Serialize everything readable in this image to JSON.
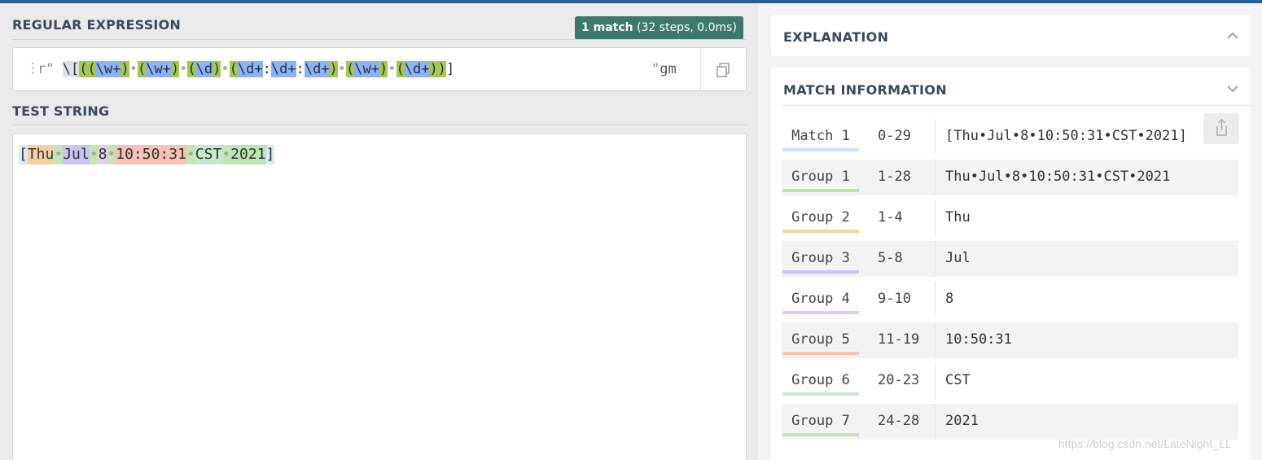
{
  "regex_section": {
    "title": "REGULAR EXPRESSION",
    "match_badge": {
      "count": "1 match",
      "detail": "(32 steps, 0.0ms)"
    },
    "delimiter_open": "r\"",
    "delimiter_close": "\"",
    "flags": "gm",
    "pattern_tokens": [
      {
        "t": "\\[",
        "k": "esc"
      },
      {
        "t": "(",
        "k": "grp"
      },
      {
        "t": "(",
        "k": "grp"
      },
      {
        "t": "\\w+",
        "k": "cls"
      },
      {
        "t": ")",
        "k": "grp"
      },
      {
        "t": "•",
        "k": "dot"
      },
      {
        "t": "(",
        "k": "grp"
      },
      {
        "t": "\\w+",
        "k": "cls"
      },
      {
        "t": ")",
        "k": "grp"
      },
      {
        "t": "•",
        "k": "dot"
      },
      {
        "t": "(",
        "k": "grp"
      },
      {
        "t": "\\d",
        "k": "cls"
      },
      {
        "t": ")",
        "k": "grp"
      },
      {
        "t": "•",
        "k": "dot"
      },
      {
        "t": "(",
        "k": "grp"
      },
      {
        "t": "\\d+",
        "k": "cls"
      },
      {
        "t": ":",
        "k": "plain"
      },
      {
        "t": "\\d+",
        "k": "cls"
      },
      {
        "t": ":",
        "k": "plain"
      },
      {
        "t": "\\d+",
        "k": "cls"
      },
      {
        "t": ")",
        "k": "grp"
      },
      {
        "t": "•",
        "k": "dot"
      },
      {
        "t": "(",
        "k": "grp"
      },
      {
        "t": "\\w+",
        "k": "cls"
      },
      {
        "t": ")",
        "k": "grp"
      },
      {
        "t": "•",
        "k": "dot"
      },
      {
        "t": "(",
        "k": "grp"
      },
      {
        "t": "\\d+",
        "k": "cls"
      },
      {
        "t": ")",
        "k": "grp"
      },
      {
        "t": ")",
        "k": "grp"
      },
      {
        "t": "]",
        "k": "plain"
      }
    ]
  },
  "test_section": {
    "title": "TEST STRING",
    "segments": [
      {
        "t": "[",
        "k": "h-m"
      },
      {
        "t": "Thu",
        "k": "h-g2"
      },
      {
        "t": "•",
        "k": "h-sp"
      },
      {
        "t": "Jul",
        "k": "h-g3"
      },
      {
        "t": "•",
        "k": "h-sp"
      },
      {
        "t": "8",
        "k": "h-g4"
      },
      {
        "t": "•",
        "k": "h-sp"
      },
      {
        "t": "10:50:31",
        "k": "h-g5"
      },
      {
        "t": "•",
        "k": "h-sp"
      },
      {
        "t": "CST",
        "k": "h-g6"
      },
      {
        "t": "•",
        "k": "h-sp"
      },
      {
        "t": "2021",
        "k": "h-g7"
      },
      {
        "t": "]",
        "k": "h-m"
      }
    ]
  },
  "explanation": {
    "title": "EXPLANATION"
  },
  "match_information": {
    "title": "MATCH INFORMATION",
    "rows": [
      {
        "name": "Match 1",
        "range": "0-29",
        "value": "[Thu•Jul•8•10:50:31•CST•2021]",
        "color": "#cde4f7"
      },
      {
        "name": "Group 1",
        "range": "1-28",
        "value": "Thu•Jul•8•10:50:31•CST•2021",
        "color": "#bfe0a6"
      },
      {
        "name": "Group 2",
        "range": "1-4",
        "value": "Thu",
        "color": "#f6d3a4"
      },
      {
        "name": "Group 3",
        "range": "5-8",
        "value": "Jul",
        "color": "#c8c4f4"
      },
      {
        "name": "Group 4",
        "range": "9-10",
        "value": "8",
        "color": "#ecc8f4"
      },
      {
        "name": "Group 5",
        "range": "11-19",
        "value": "10:50:31",
        "color": "#f7c1b6"
      },
      {
        "name": "Group 6",
        "range": "20-23",
        "value": "CST",
        "color": "#c9e6cf"
      },
      {
        "name": "Group 7",
        "range": "24-28",
        "value": "2021",
        "color": "#bfe3b4"
      }
    ]
  },
  "watermark": "https://blog.csdn.net/LateNight_LL"
}
